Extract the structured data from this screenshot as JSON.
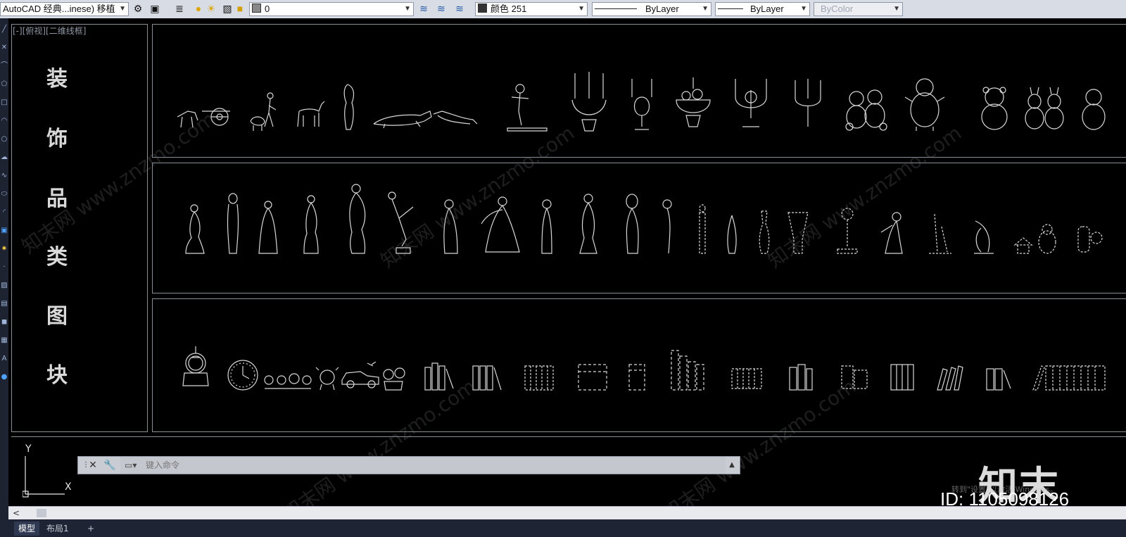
{
  "toolbar": {
    "workspace": "AutoCAD 经典...inese) 移植",
    "layer": "0",
    "color": "颜色 251",
    "linetype": "ByLayer",
    "lineweight": "ByLayer",
    "plotstyle": "ByColor"
  },
  "viewport": {
    "label": "[-][俯视][二维线框]",
    "title_chars": [
      "装",
      "饰",
      "品",
      "类",
      "图",
      "块"
    ]
  },
  "ucs": {
    "y": "Y",
    "x": "X"
  },
  "command": {
    "placeholder": "键入命令"
  },
  "overlay": {
    "logo": "知末",
    "id": "ID: 1105098126",
    "windows_notice": "转到\"设置\"以激活 Windows。",
    "watermark_text": "知末网 www.znzmo.com"
  },
  "status": {
    "model_tab": "模型",
    "layout_tab": "布局1"
  },
  "colors": {
    "toolbar": "#d8dce4",
    "canvas": "#000000",
    "line": "#d8d8d8"
  }
}
